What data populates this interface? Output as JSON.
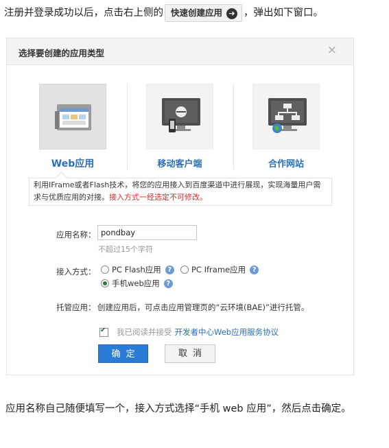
{
  "intro": {
    "before": "注册并登录成功以后，点击右上侧的",
    "button_label": "快速创建应用",
    "after": "，弹出如下窗口。"
  },
  "dialog": {
    "title": "选择要创建的应用类型",
    "close": "×",
    "types": [
      {
        "label": "Web应用",
        "icon": "web-app-icon",
        "selected": true
      },
      {
        "label": "移动客户端",
        "icon": "mobile-client-icon",
        "selected": false
      },
      {
        "label": "合作网站",
        "icon": "partner-site-icon",
        "selected": false
      }
    ],
    "description": "利用IFrame或者Flash技术，将您的应用接入到百度渠道中进行展现，实现海量用户需求与优质应用的对接。",
    "warning": "接入方式一经选定不可修改。",
    "form": {
      "name_label": "应用名称：",
      "name_value": "pondbay",
      "name_hint": "不超过15个字符",
      "access_label": "接入方式：",
      "access_options": [
        "PC Flash应用",
        "PC Iframe应用",
        "手机web应用"
      ],
      "access_selected": "手机web应用",
      "hosting_label": "托管应用：",
      "hosting_text": "创建应用后，可点击应用管理页的“云环境(BAE)”进行托管。",
      "agree_text": "我已阅读并接受",
      "agree_link": "开发者中心Web应用服务协议",
      "ok": "确定",
      "cancel": "取消"
    }
  },
  "outro": "应用名称自己随便填写一个，接入方式选择“手机 web 应用”，然后点击确定。",
  "colors": {
    "link_blue": "#2c6fb9",
    "ok_button": "#2a7bd6",
    "warning_red": "#d22c2c"
  }
}
